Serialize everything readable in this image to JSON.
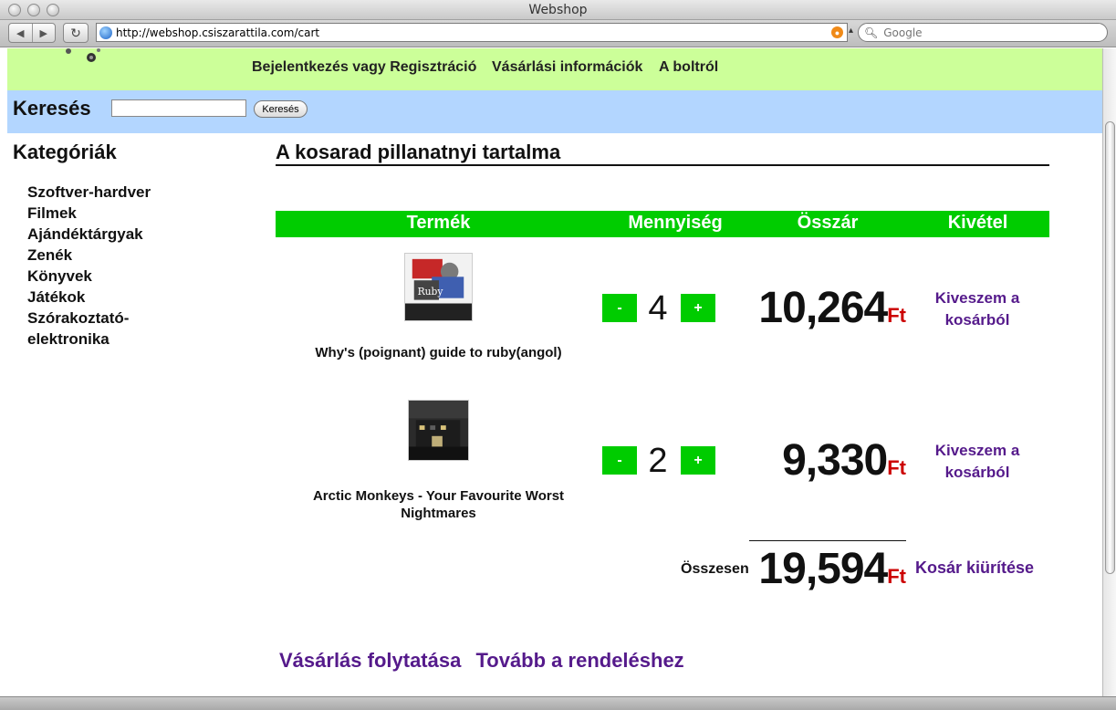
{
  "browser": {
    "window_title": "Webshop",
    "url": "http://webshop.csiszarattila.com/cart",
    "search_placeholder": "Google"
  },
  "topnav": {
    "login": "Bejelentkezés vagy Regisztráció",
    "shopping_info": "Vásárlási információk",
    "about": "A boltról"
  },
  "search": {
    "label": "Keresés",
    "button": "Keresés"
  },
  "sidebar": {
    "title": "Kategóriák",
    "items": [
      "Szoftver-hardver",
      "Filmek",
      "Ajándéktárgyak",
      "Zenék",
      "Könyvek",
      "Játékok",
      "Szórakoztató-elektronika"
    ]
  },
  "cart": {
    "title": "A kosarad pillanatnyi tartalma",
    "headers": {
      "product": "Termék",
      "quantity": "Mennyiség",
      "total_price": "Összár",
      "remove": "Kivétel"
    },
    "items": [
      {
        "name": "Why's (poignant) guide to ruby(angol)",
        "quantity": "4",
        "price": "10,264",
        "currency": "Ft",
        "remove": "Kiveszem a kosárból"
      },
      {
        "name": "Arctic Monkeys - Your Favourite Worst Nightmares",
        "quantity": "2",
        "price": "9,330",
        "currency": "Ft",
        "remove": "Kiveszem a kosárból"
      }
    ],
    "minus": "-",
    "plus": "+",
    "total_label": "Összesen",
    "total": "19,594",
    "total_currency": "Ft",
    "empty_cart": "Kosár kiürítése",
    "continue_shopping": "Vásárlás folytatása",
    "to_checkout": "Tovább a rendeléshez"
  },
  "colors": {
    "nav_bg": "#ccff99",
    "search_bg": "#b3d6ff",
    "header_green": "#00cc00",
    "link_purple": "#551a8b",
    "currency_red": "#cc0000"
  }
}
